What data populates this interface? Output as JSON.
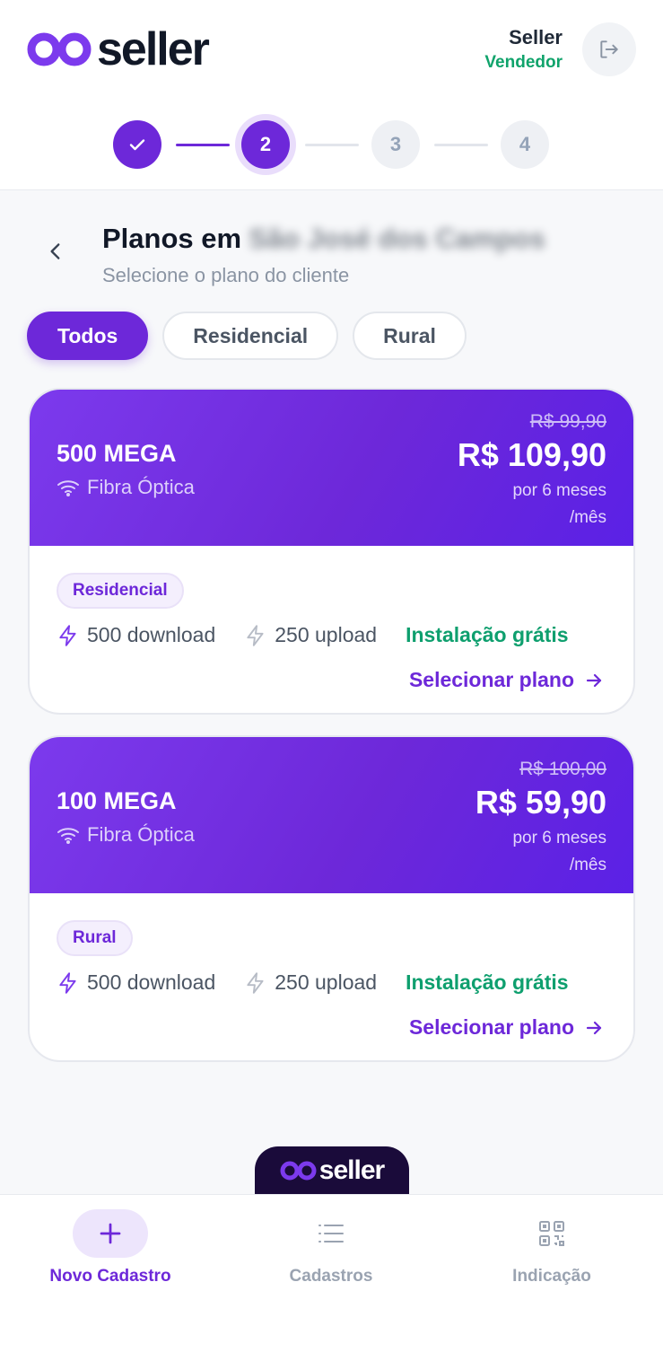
{
  "header": {
    "logo_text": "seller",
    "user_name": "Seller",
    "user_role": "Vendedor",
    "logout_icon": "logout-icon"
  },
  "stepper": {
    "steps": [
      {
        "label": "",
        "state": "done",
        "icon": "check-icon"
      },
      {
        "label": "2",
        "state": "active"
      },
      {
        "label": "3",
        "state": "todo"
      },
      {
        "label": "4",
        "state": "todo"
      }
    ]
  },
  "page": {
    "title": "Planos em",
    "city_blurred": "São José dos Campos",
    "subtitle": "Selecione o plano do cliente"
  },
  "filters": {
    "items": [
      "Todos",
      "Residencial",
      "Rural"
    ],
    "selected": "Todos"
  },
  "plans": [
    {
      "name": "500 MEGA",
      "type": "Fibra Óptica",
      "old_price": "R$ 99,90",
      "price": "R$ 109,90",
      "period": "por 6 meses",
      "per_month": "/mês",
      "badge": "Residencial",
      "download": "500 download",
      "upload": "250 upload",
      "installation": "Instalação grátis",
      "select_label": "Selecionar plano"
    },
    {
      "name": "100 MEGA",
      "type": "Fibra Óptica",
      "old_price": "R$ 100,00",
      "price": "R$ 59,90",
      "period": "por 6 meses",
      "per_month": "/mês",
      "badge": "Rural",
      "download": "500 download",
      "upload": "250 upload",
      "installation": "Instalação grátis",
      "select_label": "Selecionar plano"
    }
  ],
  "footer": {
    "logo_text": "seller"
  },
  "bottom_nav": {
    "items": [
      {
        "label": "Novo Cadastro",
        "icon": "plus-icon",
        "active": true
      },
      {
        "label": "Cadastros",
        "icon": "list-icon",
        "active": false
      },
      {
        "label": "Indicação",
        "icon": "qr-code-icon",
        "active": false
      }
    ]
  },
  "colors": {
    "primary": "#6d28d9",
    "success": "#0e9f6e",
    "muted": "#9aa3b1"
  }
}
